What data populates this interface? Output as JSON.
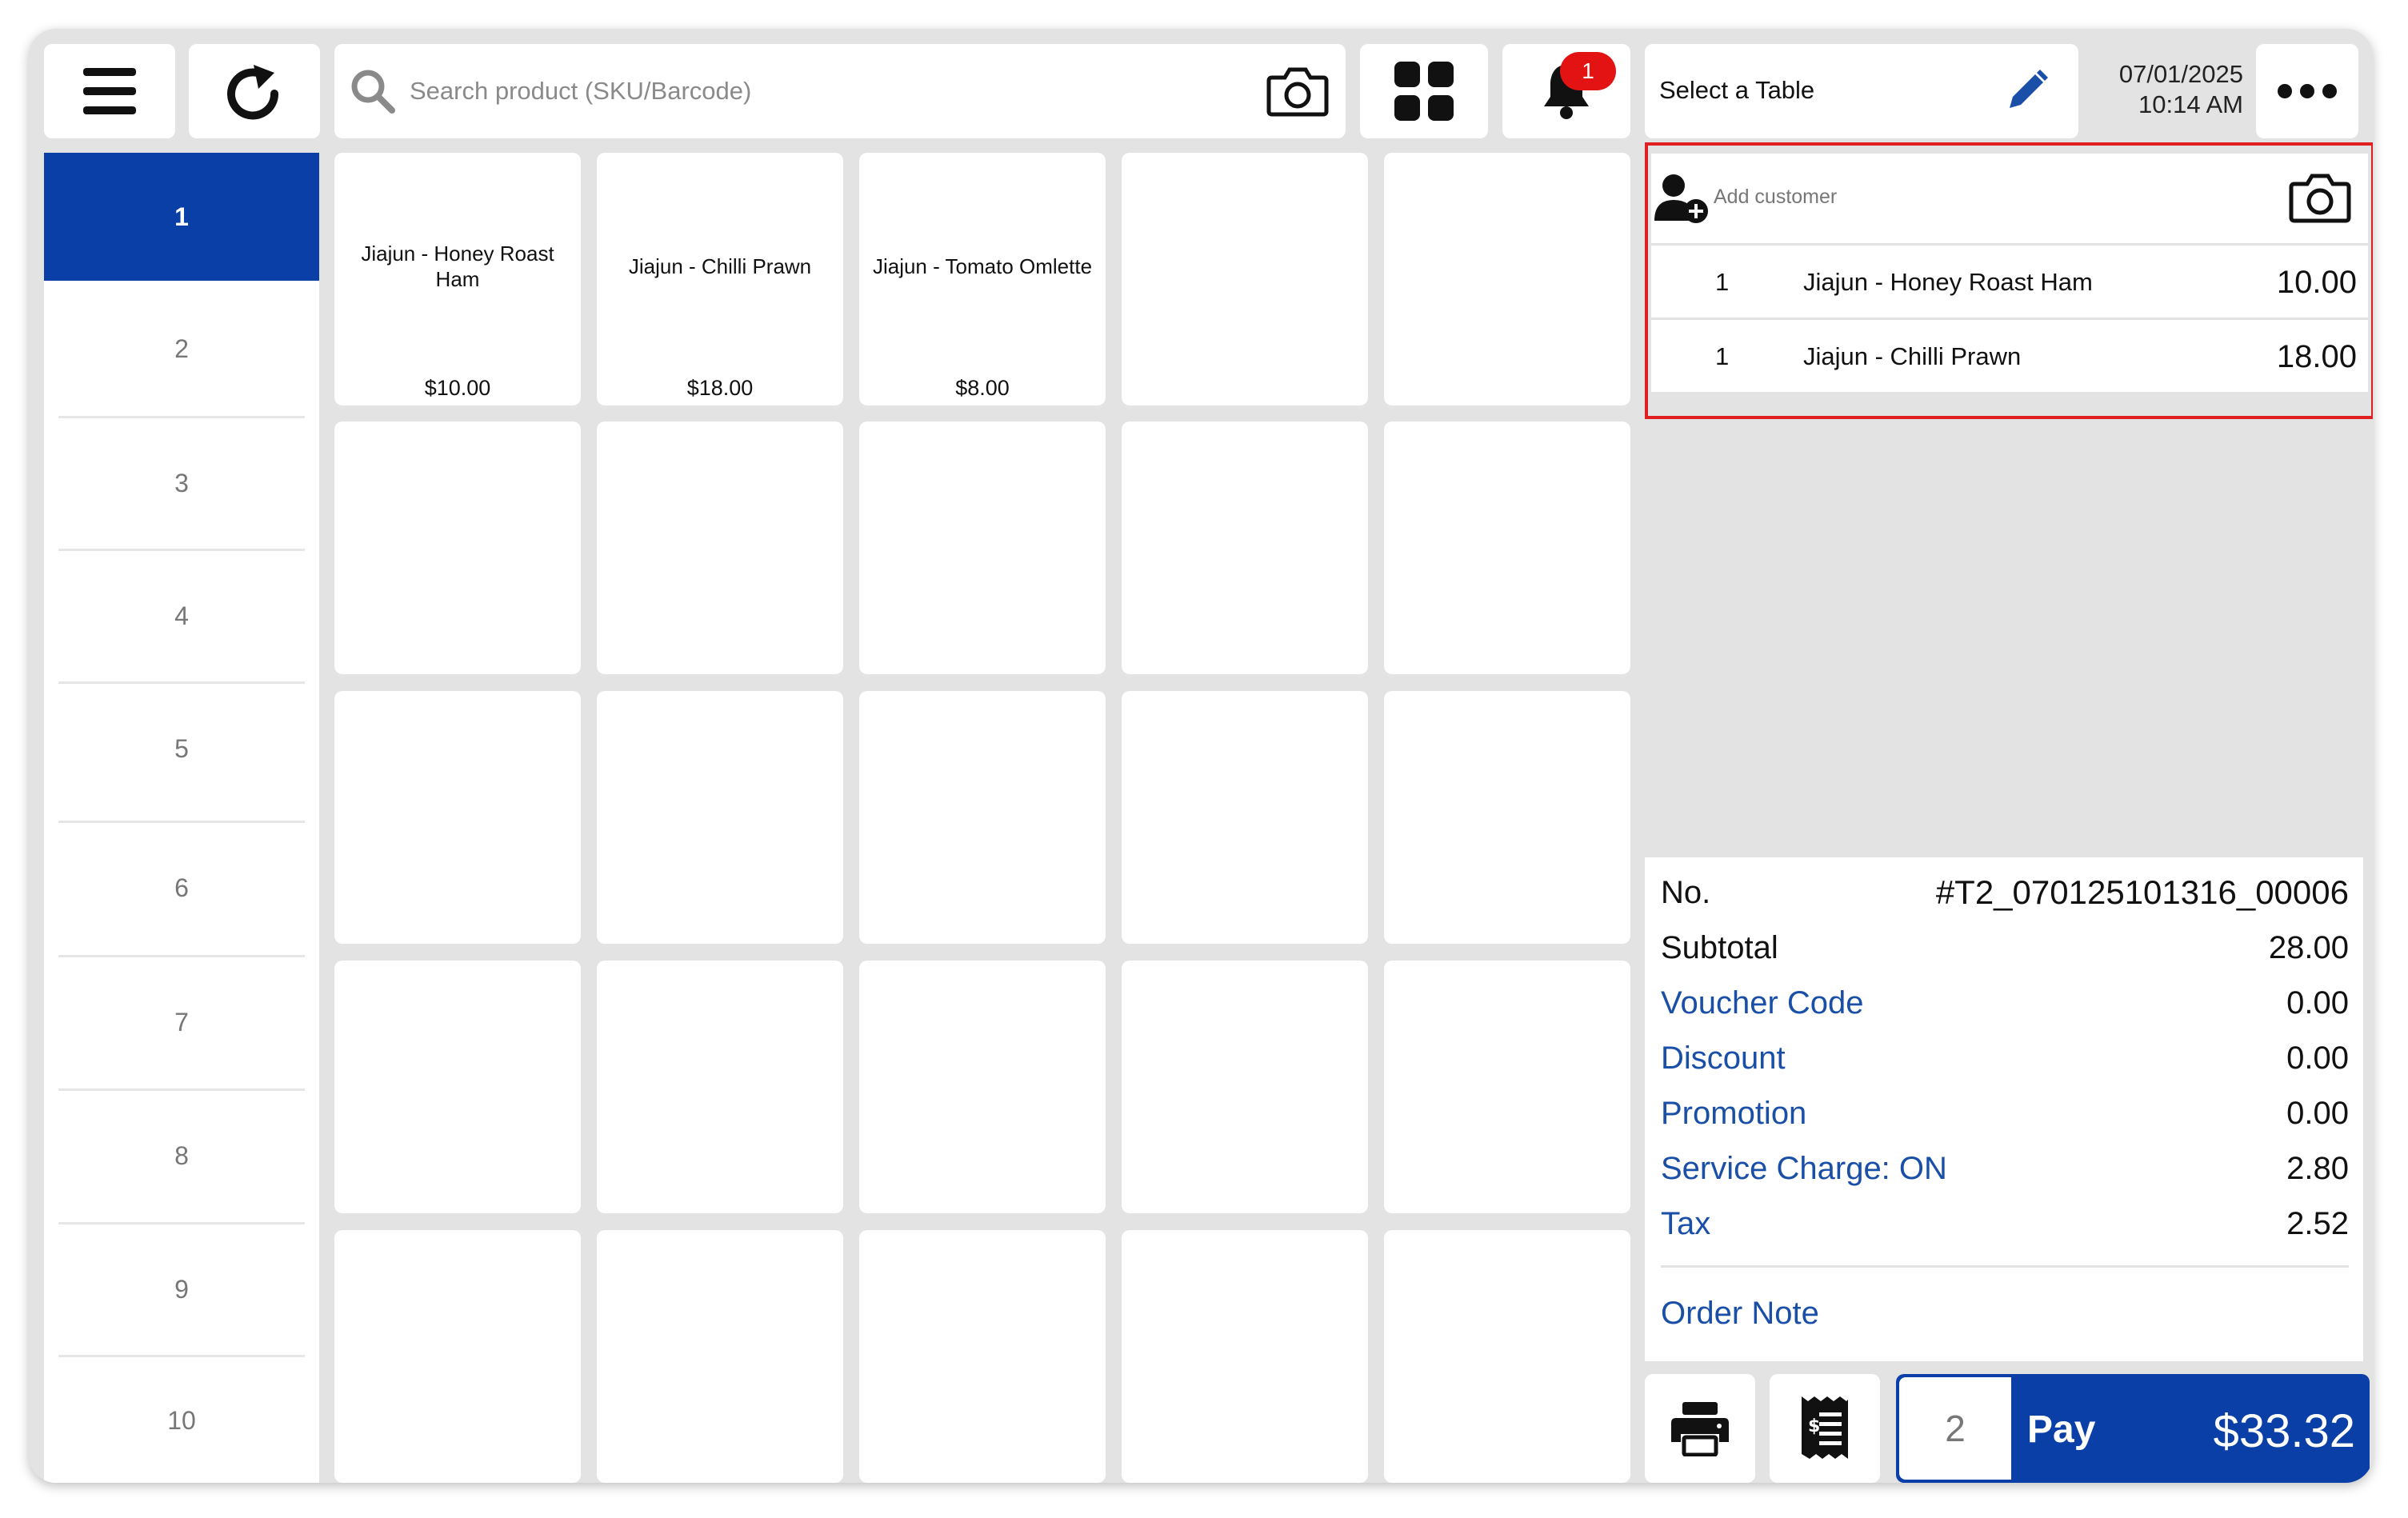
{
  "topbar": {
    "search_placeholder": "Search product (SKU/Barcode)",
    "notification_count": "1",
    "table_label": "Select a Table",
    "date": "07/01/2025",
    "time": "10:14 AM"
  },
  "categories": [
    "1",
    "2",
    "3",
    "4",
    "5",
    "6",
    "7",
    "8",
    "9",
    "10"
  ],
  "products": [
    {
      "name": "Jiajun - Honey Roast Ham",
      "price": "$10.00"
    },
    {
      "name": "Jiajun - Chilli Prawn",
      "price": "$18.00"
    },
    {
      "name": "Jiajun - Tomato Omlette",
      "price": "$8.00"
    }
  ],
  "order": {
    "customer_label": "Add customer",
    "items": [
      {
        "qty": "1",
        "name": "Jiajun - Honey Roast Ham",
        "amount": "10.00"
      },
      {
        "qty": "1",
        "name": "Jiajun - Chilli Prawn",
        "amount": "18.00"
      }
    ]
  },
  "summary": {
    "no_label": "No.",
    "no_value": "#T2_070125101316_00006",
    "subtotal_label": "Subtotal",
    "subtotal_value": "28.00",
    "voucher_label": "Voucher Code",
    "voucher_value": "0.00",
    "discount_label": "Discount",
    "discount_value": "0.00",
    "promotion_label": "Promotion",
    "promotion_value": "0.00",
    "service_label": "Service Charge: ON",
    "service_value": "2.80",
    "tax_label": "Tax",
    "tax_value": "2.52",
    "order_note_label": "Order Note"
  },
  "footer": {
    "pax_count": "2",
    "pay_label": "Pay",
    "pay_total": "$33.32"
  },
  "colors": {
    "accent": "#0a3fa8",
    "link": "#1a4fa8",
    "badge": "#e31313",
    "highlight_border": "#e02020",
    "background": "#e3e3e3"
  }
}
